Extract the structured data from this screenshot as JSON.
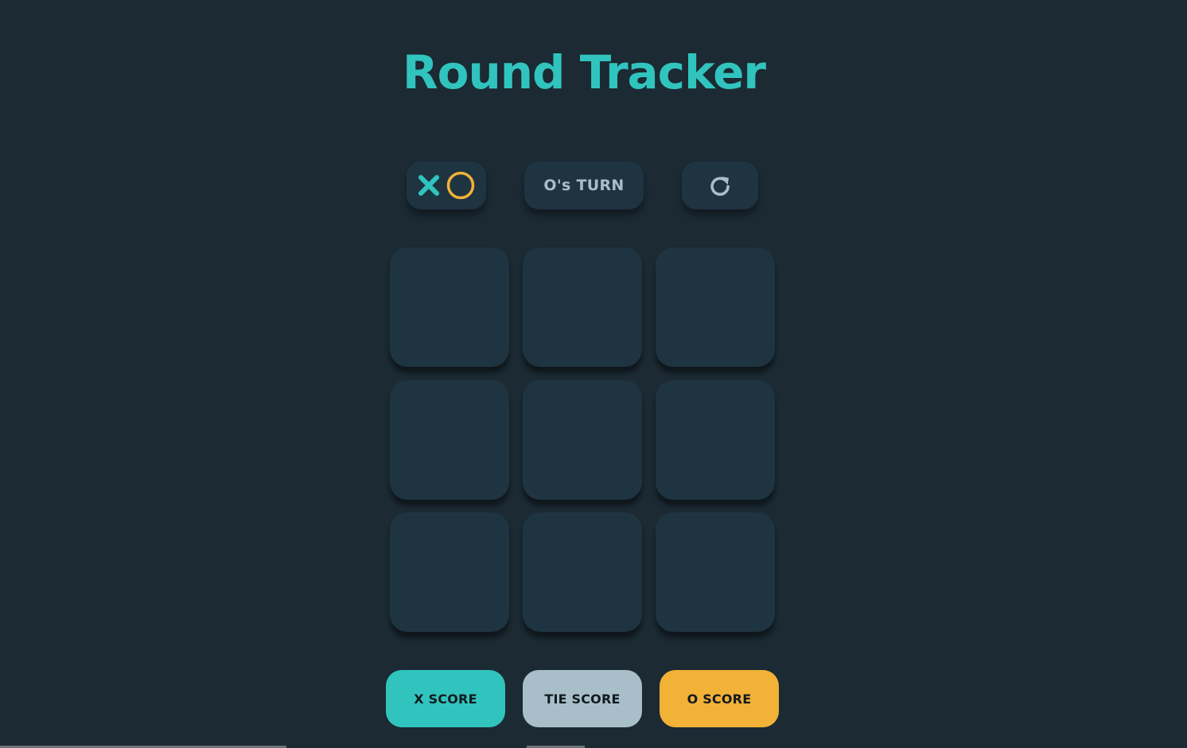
{
  "title": "Round Tracker",
  "controls": {
    "logo_icons": [
      "x-icon",
      "o-icon"
    ],
    "turn_text": "O's TURN",
    "restart_icon": "restart-icon"
  },
  "board": {
    "cells": [
      "",
      "",
      "",
      "",
      "",
      "",
      "",
      "",
      ""
    ]
  },
  "scores": {
    "x_label": "X SCORE",
    "tie_label": "TIE SCORE",
    "o_label": "O SCORE"
  },
  "colors": {
    "background": "#1b2a33",
    "surface": "#1f3441",
    "x_accent": "#31c4be",
    "o_accent": "#f2b137",
    "neutral": "#a8bfc9"
  }
}
